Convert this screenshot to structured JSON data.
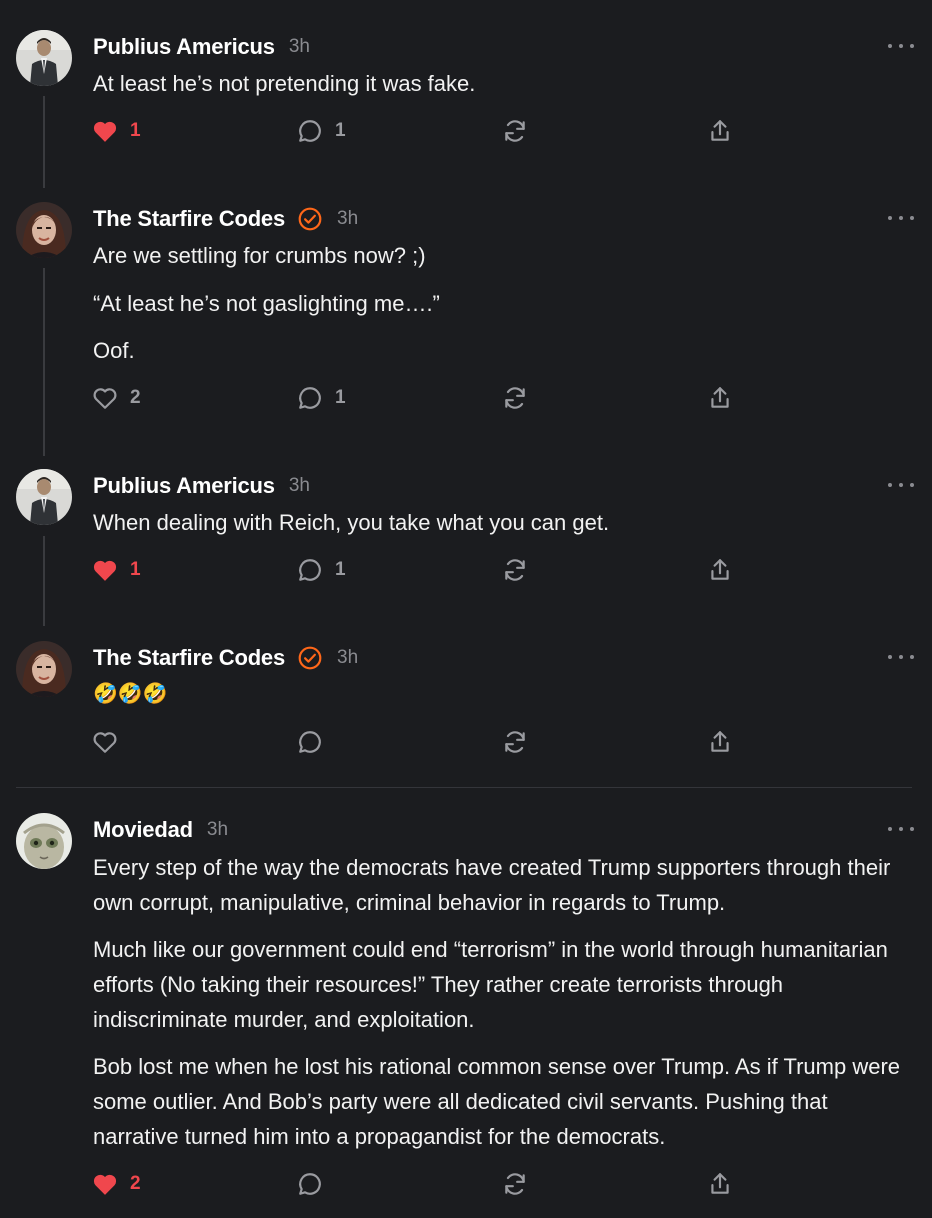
{
  "comments": [
    {
      "author": "Publius Americus",
      "time": "3h",
      "verified": false,
      "paragraphs": [
        "At least he’s not pretending it was fake."
      ],
      "likes": "1",
      "liked": true,
      "replies": "1"
    },
    {
      "author": "The Starfire Codes",
      "time": "3h",
      "verified": true,
      "paragraphs": [
        "Are we settling for crumbs now? ;)",
        "“At least he’s not gaslighting me….”",
        "Oof."
      ],
      "likes": "2",
      "liked": false,
      "replies": "1"
    },
    {
      "author": "Publius Americus",
      "time": "3h",
      "verified": false,
      "paragraphs": [
        "When dealing with Reich, you take what you can get."
      ],
      "likes": "1",
      "liked": true,
      "replies": "1"
    },
    {
      "author": "The Starfire Codes",
      "time": "3h",
      "verified": true,
      "paragraphs": [
        "🤣🤣🤣"
      ],
      "likes": "",
      "liked": false,
      "replies": ""
    },
    {
      "author": "Moviedad",
      "time": "3h",
      "verified": false,
      "paragraphs": [
        "Every step of the way the democrats have created Trump supporters through their own corrupt, manipulative, criminal behavior in regards to Trump.",
        "Much like our government could end “terrorism” in the world through humanitarian efforts (No taking their resources!” They rather create terrorists through indiscriminate murder, and exploitation.",
        "Bob lost me when he lost his rational common sense over Trump. As if Trump were some outlier. And Bob’s party were all dedicated civil servants. Pushing that narrative turned him into a propagandist for the democrats."
      ],
      "likes": "2",
      "liked": true,
      "replies": ""
    }
  ],
  "icons": {
    "like": "heart-icon",
    "reply": "comment-bubble-icon",
    "restack": "restack-icon",
    "share": "share-icon",
    "more": "more-horizontal-icon",
    "verified": "verified-check-icon"
  },
  "colors": {
    "background": "#1b1c1f",
    "liked": "#f0474d",
    "verified": "#ff6719",
    "muted": "#8a8b90"
  }
}
